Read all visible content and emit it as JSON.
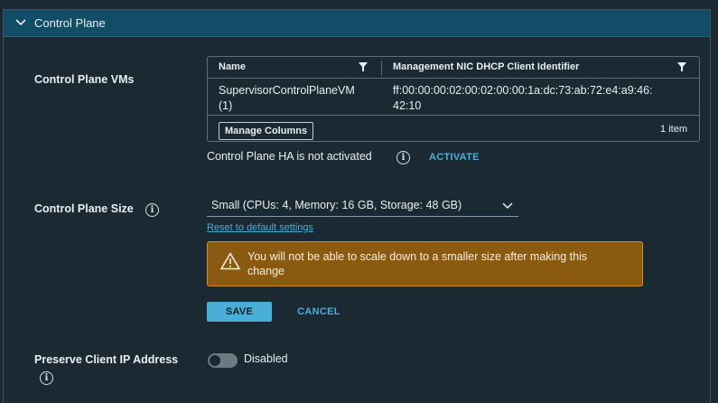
{
  "panel": {
    "title": "Control Plane"
  },
  "control_plane_vms": {
    "label": "Control Plane VMs",
    "columns": [
      "Name",
      "Management NIC DHCP Client Identifier"
    ],
    "rows": [
      {
        "name_line1": "SupervisorControlPlaneVM",
        "name_line2": "(1)",
        "identifier_line1": "ff:00:00:00:02:00:02:00:00:1a:dc:73:ab:72:e4:a9:46:",
        "identifier_line2": "42:10"
      }
    ],
    "manage_columns_label": "Manage Columns",
    "item_count": "1 item"
  },
  "ha": {
    "status_text": "Control Plane HA is not activated",
    "activate_label": "ACTIVATE"
  },
  "size": {
    "label": "Control Plane Size",
    "selected": "Small (CPUs: 4, Memory: 16 GB, Storage: 48 GB)",
    "reset_label": "Reset to default settings",
    "warning_line1": "You will not be able to scale down to a smaller size after making this",
    "warning_line2": "change",
    "save_label": "SAVE",
    "cancel_label": "CANCEL"
  },
  "preserve_ip": {
    "label": "Preserve Client IP Address",
    "state_label": "Disabled",
    "enabled": false
  },
  "colors": {
    "header_bg": "#124d68",
    "accent": "#49afd9",
    "warning_bg": "#8b5a11",
    "warning_border": "#d28f1d"
  }
}
